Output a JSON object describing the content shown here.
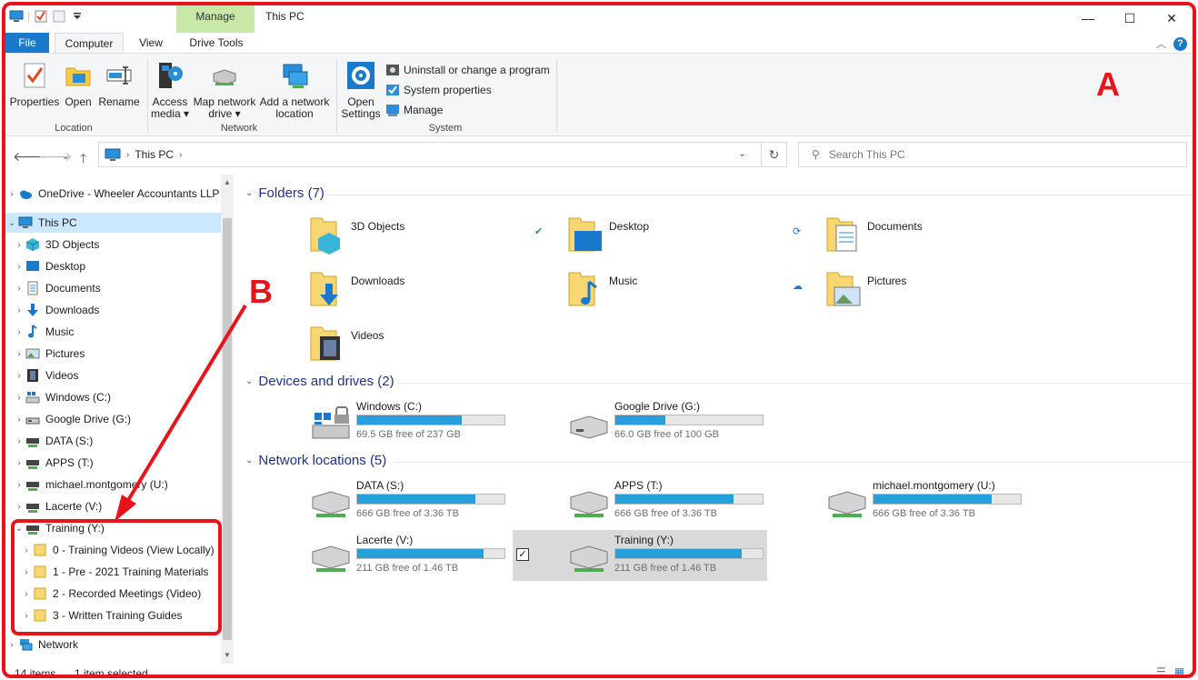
{
  "titlebar": {
    "manage_tab": "Manage",
    "title": "This PC",
    "minimize": "—",
    "maximize": "☐",
    "close": "✕"
  },
  "tabs": {
    "file": "File",
    "computer": "Computer",
    "view": "View",
    "drive_tools": "Drive Tools"
  },
  "ribbon": {
    "location": {
      "label": "Location",
      "buttons": [
        "Properties",
        "Open",
        "Rename"
      ]
    },
    "network": {
      "label": "Network",
      "access_media_1": "Access",
      "access_media_2": "media ▾",
      "map_drive_1": "Map network",
      "map_drive_2": "drive ▾",
      "add_location_1": "Add a network",
      "add_location_2": "location"
    },
    "system": {
      "label": "System",
      "open_settings_1": "Open",
      "open_settings_2": "Settings",
      "uninstall": "Uninstall or change a program",
      "system_properties": "System properties",
      "manage": "Manage"
    }
  },
  "annotations": {
    "a": "A",
    "b": "B"
  },
  "address": {
    "path": "This PC",
    "search_placeholder": "Search This PC"
  },
  "nav": {
    "onedrive": "OneDrive - Wheeler Accountants LLP",
    "this_pc": "This PC",
    "items": [
      "3D Objects",
      "Desktop",
      "Documents",
      "Downloads",
      "Music",
      "Pictures",
      "Videos",
      "Windows (C:)",
      "Google Drive (G:)",
      "DATA (S:)",
      "APPS (T:)",
      "michael.montgomery (U:)",
      "Lacerte (V:)"
    ],
    "training": "Training (Y:)",
    "training_children": [
      "0 - Training Videos (View Locally)",
      "1 - Pre - 2021 Training Materials",
      "2 - Recorded Meetings (Video)",
      "3 - Written Training Guides"
    ],
    "network": "Network"
  },
  "sections": {
    "folders": "Folders (7)",
    "devices": "Devices and drives (2)",
    "network": "Network locations (5)"
  },
  "folders": [
    "3D Objects",
    "Desktop",
    "Documents",
    "Downloads",
    "Music",
    "Pictures",
    "Videos"
  ],
  "devices": [
    {
      "name": "Windows (C:)",
      "free": "69.5 GB free of 237 GB",
      "used_fraction": 0.71
    },
    {
      "name": "Google Drive (G:)",
      "free": "66.0 GB free of 100 GB",
      "used_fraction": 0.34
    }
  ],
  "network_locations": [
    {
      "name": "DATA (S:)",
      "free": "666 GB free of 3.36 TB",
      "used_fraction": 0.8
    },
    {
      "name": "APPS (T:)",
      "free": "666 GB free of 3.36 TB",
      "used_fraction": 0.8
    },
    {
      "name": "michael.montgomery (U:)",
      "free": "666 GB free of 3.36 TB",
      "used_fraction": 0.8
    },
    {
      "name": "Lacerte (V:)",
      "free": "211 GB free of 1.46 TB",
      "used_fraction": 0.86
    },
    {
      "name": "Training (Y:)",
      "free": "211 GB free of 1.46 TB",
      "used_fraction": 0.86
    }
  ],
  "status": {
    "count": "14 items",
    "selected": "1 item selected"
  },
  "colors": {
    "annotation_red": "#e8141b",
    "file_tab": "#1979ca",
    "manage_tab": "#c8e8a8",
    "drive_bar": "#26a0da",
    "section_heading": "#1e3287"
  }
}
